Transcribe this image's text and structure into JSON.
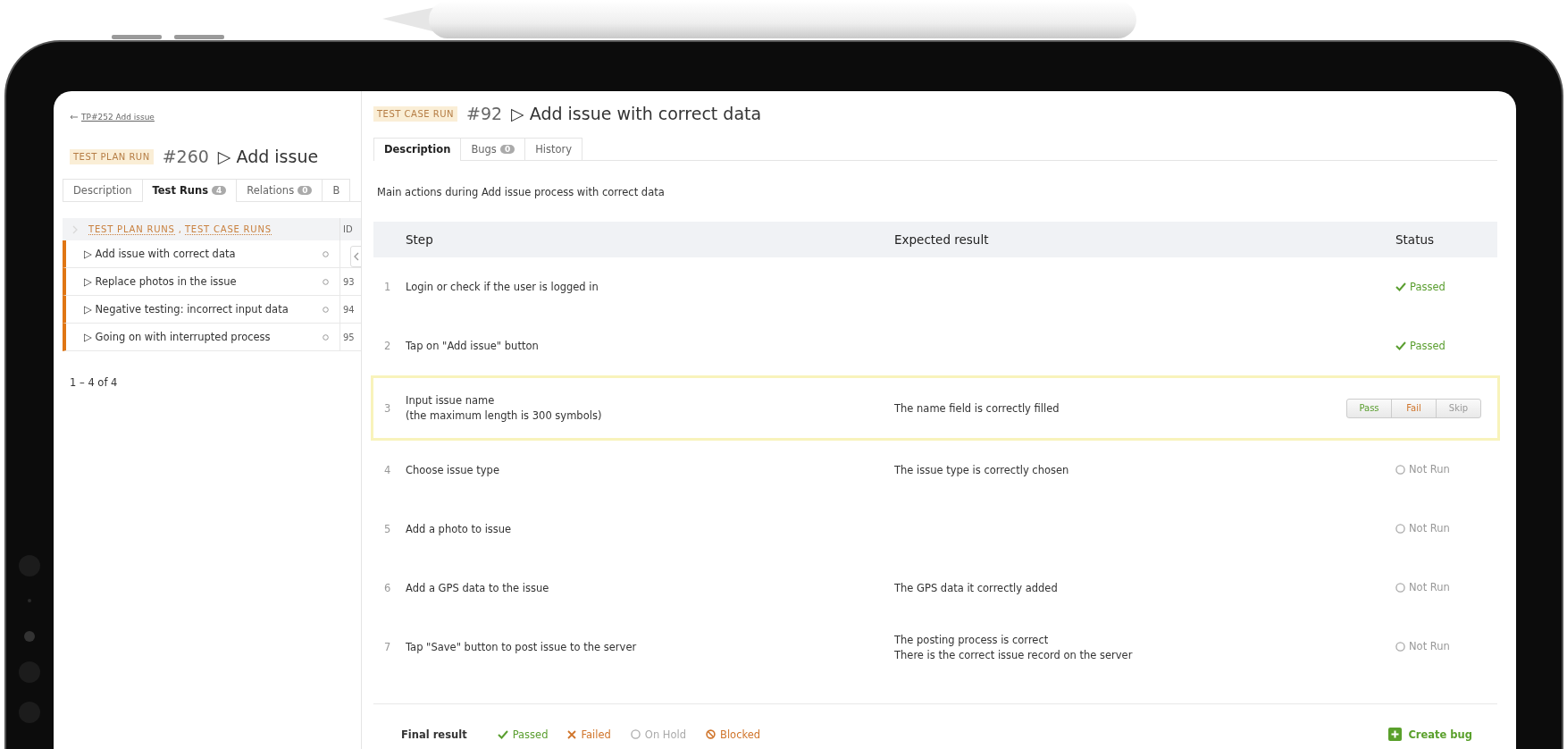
{
  "left_panel": {
    "back_link": "TP#252 Add issue",
    "badge": "TEST PLAN RUN",
    "number": "#260",
    "title": "▷ Add issue",
    "tabs": [
      {
        "label": "Description",
        "selected": false
      },
      {
        "label": "Test Runs",
        "count": "4",
        "selected": true
      },
      {
        "label": "Relations",
        "count": "0",
        "selected": false
      },
      {
        "label": "B",
        "selected": false
      }
    ],
    "table": {
      "name_column": [
        "TEST PLAN RUNS",
        "TEST CASE RUNS"
      ],
      "name_separator": ",",
      "id_column": "ID",
      "rows": [
        {
          "name": "▷ Add issue with correct data"
        },
        {
          "name": "▷ Replace photos in the issue",
          "id": "93"
        },
        {
          "name": "▷ Negative testing: incorrect input data",
          "id": "94"
        },
        {
          "name": "▷ Going on with interrupted process",
          "id": "95"
        }
      ]
    },
    "pagination": "1 – 4 of 4"
  },
  "right_panel": {
    "badge": "TEST CASE RUN",
    "number": "#92",
    "title": "▷ Add issue with correct data",
    "tabs": [
      {
        "label": "Description",
        "selected": true
      },
      {
        "label": "Bugs",
        "count": "0",
        "selected": false
      },
      {
        "label": "History",
        "selected": false
      }
    ],
    "description": "Main actions during Add issue process with correct data",
    "steps": {
      "columns": [
        "Step",
        "Expected result",
        "Status"
      ],
      "rows": [
        {
          "number": "1",
          "step": [
            "Login or check if the user is logged in"
          ],
          "expected": [],
          "highlighted": false,
          "status": {
            "kind": "passed",
            "label": "Passed"
          }
        },
        {
          "number": "2",
          "step": [
            "Tap on \"Add issue\" button"
          ],
          "expected": [],
          "highlighted": false,
          "status": {
            "kind": "passed",
            "label": "Passed"
          }
        },
        {
          "number": "3",
          "step": [
            "Input issue name",
            "(the maximum length is 300 symbols)"
          ],
          "expected": [
            "The name field is correctly filled"
          ],
          "highlighted": true,
          "status": {
            "kind": "pending",
            "buttons": [
              {
                "kind": "pass",
                "label": "Pass"
              },
              {
                "kind": "fail",
                "label": "Fail"
              },
              {
                "kind": "skip",
                "label": "Skip"
              }
            ]
          }
        },
        {
          "number": "4",
          "step": [
            "Choose issue type"
          ],
          "expected": [
            "The issue type is correctly chosen"
          ],
          "highlighted": false,
          "status": {
            "kind": "not_run",
            "label": "Not Run"
          }
        },
        {
          "number": "5",
          "step": [
            "Add a photo to issue"
          ],
          "expected": [],
          "highlighted": false,
          "status": {
            "kind": "not_run",
            "label": "Not Run"
          }
        },
        {
          "number": "6",
          "step": [
            "Add a GPS data to the issue"
          ],
          "expected": [
            "The GPS data it correctly added"
          ],
          "highlighted": false,
          "status": {
            "kind": "not_run",
            "label": "Not Run"
          }
        },
        {
          "number": "7",
          "step": [
            "Tap \"Save\" button to post issue to the server"
          ],
          "expected": [
            "The posting process is correct",
            "There is the correct issue record on the server"
          ],
          "highlighted": false,
          "status": {
            "kind": "not_run",
            "label": "Not Run"
          }
        }
      ]
    },
    "final_result": {
      "label": "Final result",
      "options": [
        {
          "kind": "passed",
          "label": "Passed"
        },
        {
          "kind": "failed",
          "label": "Failed"
        },
        {
          "kind": "on_hold",
          "label": "On Hold"
        },
        {
          "kind": "blocked",
          "label": "Blocked"
        }
      ],
      "create_bug": "Create bug"
    }
  }
}
